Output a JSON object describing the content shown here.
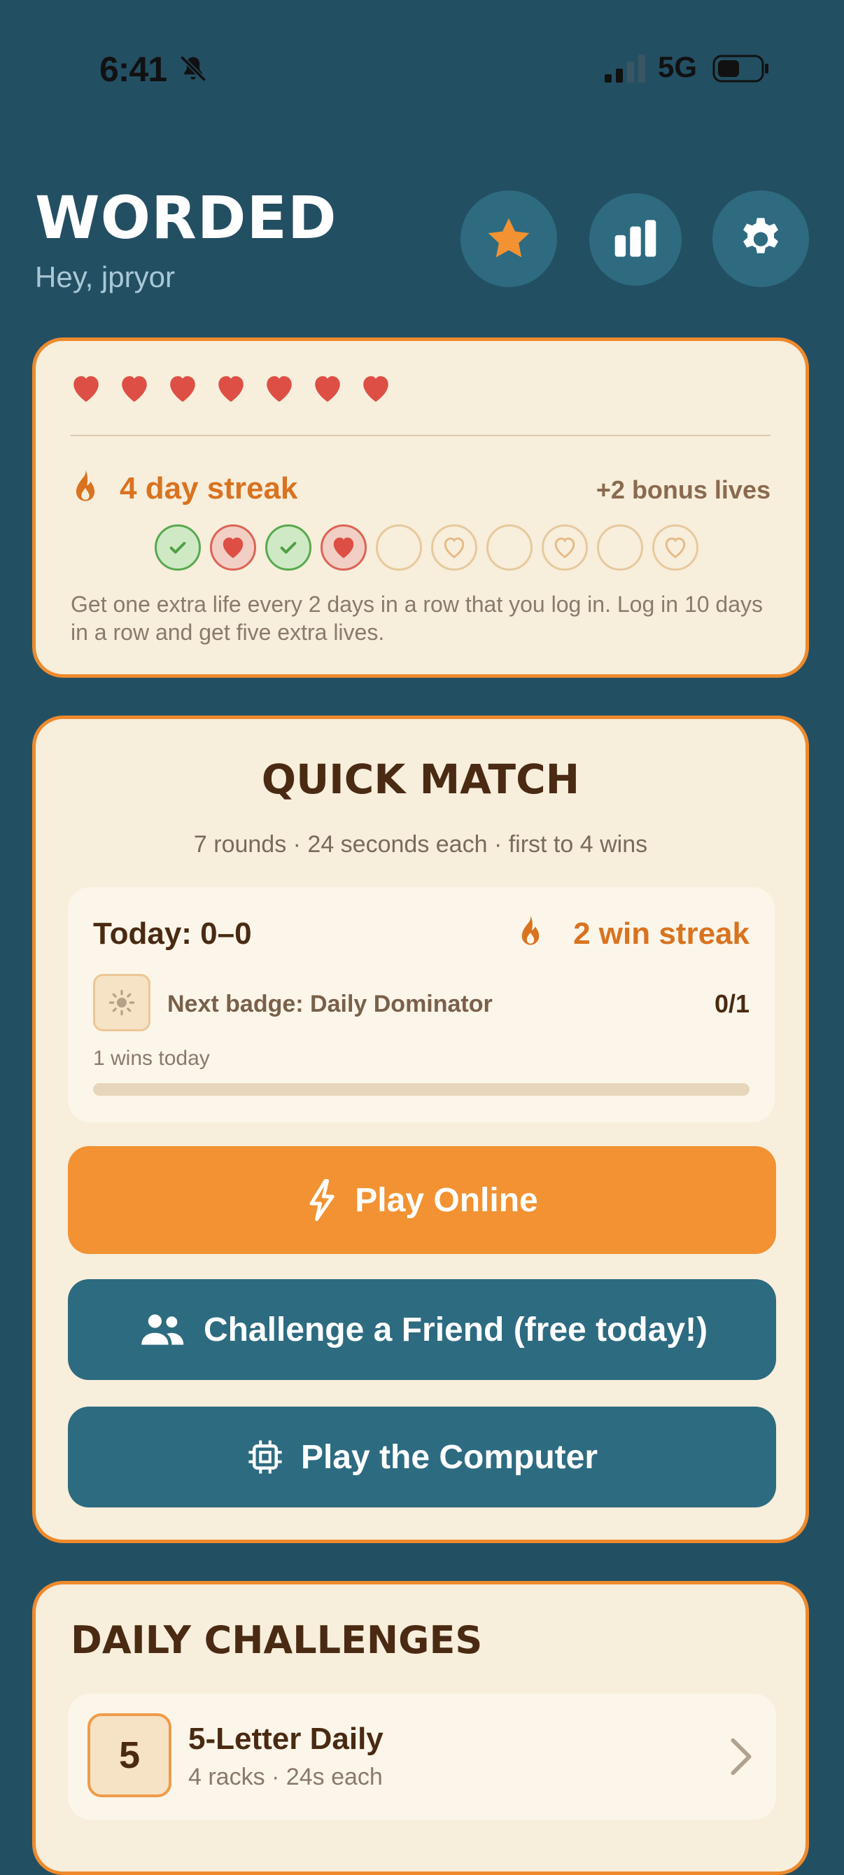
{
  "status_bar": {
    "time": "6:41",
    "network": "5G"
  },
  "header": {
    "title": "WORDED",
    "greeting": "Hey, jpryor"
  },
  "lives": {
    "hearts_count": 7,
    "streak_label": "4 day streak",
    "bonus_label": "+2 bonus lives",
    "streak_days": [
      "check",
      "heart",
      "check",
      "heart",
      "empty",
      "bonus",
      "empty",
      "bonus",
      "empty",
      "bonus"
    ],
    "description": "Get one extra life every 2 days in a row that you log in. Log in 10 days in a row and get five extra lives."
  },
  "quick_match": {
    "title": "QUICK MATCH",
    "subtitle": "7 rounds · 24 seconds each · first to 4 wins",
    "today_score": "Today: 0–0",
    "win_streak": "2 win streak",
    "badge_label": "Next badge: Daily Dominator",
    "badge_count": "0/1",
    "wins_today": "1 wins today",
    "progress_fraction": 0,
    "buttons": {
      "online": "Play Online",
      "friend": "Challenge a Friend (free today!)",
      "computer": "Play the Computer"
    }
  },
  "daily_challenges": {
    "title": "DAILY CHALLENGES",
    "items": [
      {
        "number": "5",
        "name": "5-Letter Daily",
        "meta": "4 racks · 24s each"
      }
    ]
  },
  "colors": {
    "background": "#234f63",
    "card": "#f7eedc",
    "accent_orange": "#ee8a2c",
    "button_teal": "#2d6b80",
    "heart_red": "#dd4f45"
  }
}
